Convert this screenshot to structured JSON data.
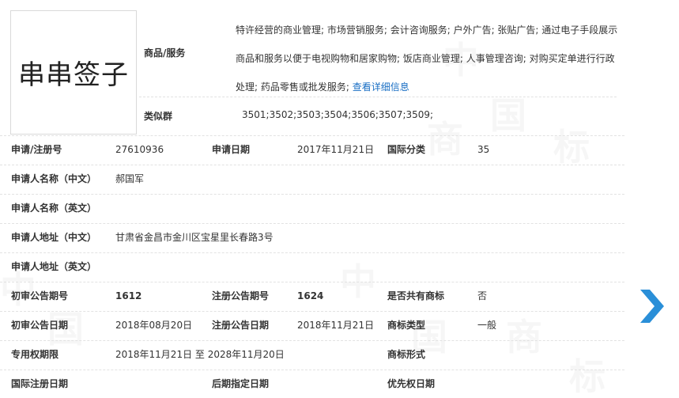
{
  "trademark": {
    "name": "串串签子",
    "goods_label": "商品/服务",
    "goods_text": "特许经营的商业管理; 市场营销服务; 会计咨询服务; 户外广告; 张贴广告; 通过电子手段展示商品和服务以便于电视购物和居家购物; 饭店商业管理; 人事管理咨询; 对购买定单进行行政处理; 药品零售或批发服务; ",
    "goods_link": "查看详细信息",
    "similar_label": "类似群",
    "similar_value": "3501;3502;3503;3504;3506;3507;3509;"
  },
  "fields": {
    "reg_no_label": "申请/注册号",
    "reg_no": "27610936",
    "apply_date_label": "申请日期",
    "apply_date": "2017年11月21日",
    "intl_class_label": "国际分类",
    "intl_class": "35",
    "applicant_cn_label": "申请人名称（中文）",
    "applicant_cn": "郝国军",
    "applicant_en_label": "申请人名称（英文）",
    "applicant_en": "",
    "address_cn_label": "申请人地址（中文）",
    "address_cn": "甘肃省金昌市金川区宝星里长春路3号",
    "address_en_label": "申请人地址（英文）",
    "address_en": "",
    "prelim_issue_label": "初审公告期号",
    "prelim_issue": "1612",
    "reg_issue_label": "注册公告期号",
    "reg_issue": "1624",
    "shared_label": "是否共有商标",
    "shared": "否",
    "prelim_date_label": "初审公告日期",
    "prelim_date": "2018年08月20日",
    "reg_date_label": "注册公告日期",
    "reg_date": "2018年11月21日",
    "tm_type_label": "商标类型",
    "tm_type": "一般",
    "exclusive_label": "专用权期限",
    "exclusive": "2018年11月21日 至 2028年11月20日",
    "tm_form_label": "商标形式",
    "tm_form": "",
    "intl_reg_label": "国际注册日期",
    "intl_reg": "",
    "later_label": "后期指定日期",
    "later": "",
    "priority_label": "优先权日期",
    "priority": ""
  },
  "colors": {
    "link": "#1a6fc4",
    "arrow": "#2a8fd8"
  },
  "icons": {
    "next": "chevron-right-icon"
  }
}
